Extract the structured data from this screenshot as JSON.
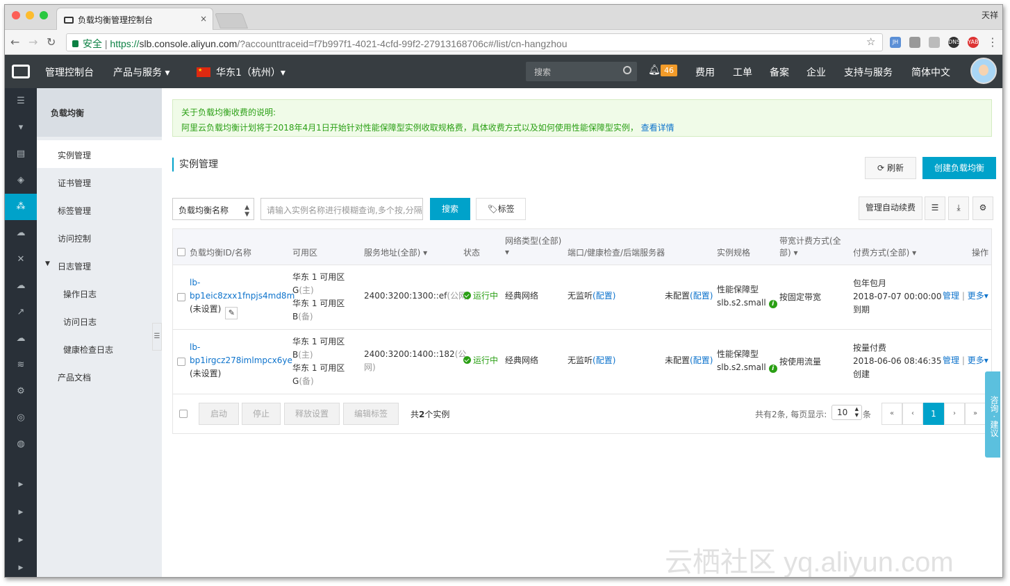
{
  "browser": {
    "tab_title": "负载均衡管理控制台",
    "tab_close": "×",
    "profile_name": "天祥",
    "security_label": "安全",
    "url_scheme": "https://",
    "url_host": "slb.console.aliyun.com",
    "url_rest": "/?accounttraceid=f7b997f1-4021-4cfd-99f2-27913168706c#/list/cn-hangzhou",
    "nav_back": "←",
    "nav_forward": "→",
    "nav_reload": "↻",
    "star": "☆",
    "menu": "⋮"
  },
  "topnav": {
    "console": "管理控制台",
    "products": "产品与服务 ▾",
    "region": "华东1（杭州）▾",
    "search_placeholder": "搜索",
    "notifications": "46",
    "billing": "费用",
    "tickets": "工单",
    "icp": "备案",
    "enterprise": "企业",
    "support": "支持与服务",
    "language": "简体中文"
  },
  "sidemenu": {
    "title": "负载均衡",
    "items": [
      {
        "label": "实例管理"
      },
      {
        "label": "证书管理"
      },
      {
        "label": "标签管理"
      },
      {
        "label": "访问控制"
      },
      {
        "label": "日志管理"
      },
      {
        "label": "操作日志"
      },
      {
        "label": "访问日志"
      },
      {
        "label": "健康检查日志"
      },
      {
        "label": "产品文档"
      }
    ]
  },
  "notice": {
    "title": "关于负载均衡收费的说明:",
    "text": "阿里云负载均衡计划将于2018年4月1日开始针对性能保障型实例收取规格费，具体收费方式以及如何使用性能保障型实例，",
    "link": "查看详情"
  },
  "page": {
    "title": "实例管理",
    "refresh": "刷新",
    "create": "创建负载均衡",
    "filter_select": "负载均衡名称",
    "search_placeholder": "请输入实例名称进行模糊查询,多个按,分隔",
    "search_button": "搜索",
    "tag_button": "标签",
    "auto_renew": "管理自动续费"
  },
  "table": {
    "headers": {
      "id": "负载均衡ID/名称",
      "zone": "可用区",
      "address": "服务地址(全部) ▾",
      "status": "状态",
      "network": "网络类型(全部)",
      "network_arrow": "▾",
      "ports": "端口/健康检查/后端服务器",
      "spec": "实例规格",
      "bandwidth_l1": "带宽计费方式(全",
      "bandwidth_l2": "部) ▾",
      "payment": "付费方式(全部) ▾",
      "action": "操作"
    },
    "rows": [
      {
        "id_l1": "lb-",
        "id_l2": "bp1eic8zxx1fnpjs4md8m",
        "name": "(未设置)",
        "zone1": "华东 1 可用区",
        "zone1b": "G",
        "zone1tag": "(主)",
        "zone2": "华东 1 可用区",
        "zone2b": "B",
        "zone2tag": "(备)",
        "address": "2400:3200:1300::ef",
        "address_tag": "(公网)",
        "status": "运行中",
        "network": "经典网络",
        "listener": "无监听",
        "listener_link": "(配置)",
        "backend": "未配置",
        "backend_link": "(配置)",
        "spec_l1": "性能保障型",
        "spec_l2": "slb.s2.small",
        "bandwidth": "按固定带宽",
        "pay_l1": "包年包月",
        "pay_l2": "2018-07-07 00:00:00",
        "pay_l3": "到期",
        "manage": "管理",
        "more": "更多"
      },
      {
        "id_l1": "lb-",
        "id_l2": "bp1irgcz278imlmpcx6ye",
        "name": "(未设置)",
        "zone1": "华东 1 可用区",
        "zone1b": "B",
        "zone1tag": "(主)",
        "zone2": "华东 1 可用区",
        "zone2b": "G",
        "zone2tag": "(备)",
        "address": "2400:3200:1400::182",
        "address_tag": "(公",
        "address_tag2": "网)",
        "status": "运行中",
        "network": "经典网络",
        "listener": "无监听",
        "listener_link": "(配置)",
        "backend": "未配置",
        "backend_link": "(配置)",
        "spec_l1": "性能保障型",
        "spec_l2": "slb.s2.small",
        "bandwidth": "按使用流量",
        "pay_l1": "按量付费",
        "pay_l2": "2018-06-06 08:46:35",
        "pay_l3": "创建",
        "manage": "管理",
        "more": "更多"
      }
    ],
    "footer": {
      "start": "启动",
      "stop": "停止",
      "release": "释放设置",
      "edit_tags": "编辑标签",
      "count_pre": "共",
      "count_num": "2",
      "count_post": "个实例",
      "summary": "共有2条, 每页显示:",
      "page_size": "10",
      "page_size_unit": "条",
      "first": "«",
      "prev": "‹",
      "current": "1",
      "next": "›",
      "last": "»"
    }
  },
  "feedback": "咨询 · 建议",
  "watermark": "云栖社区 yq.aliyun.com"
}
